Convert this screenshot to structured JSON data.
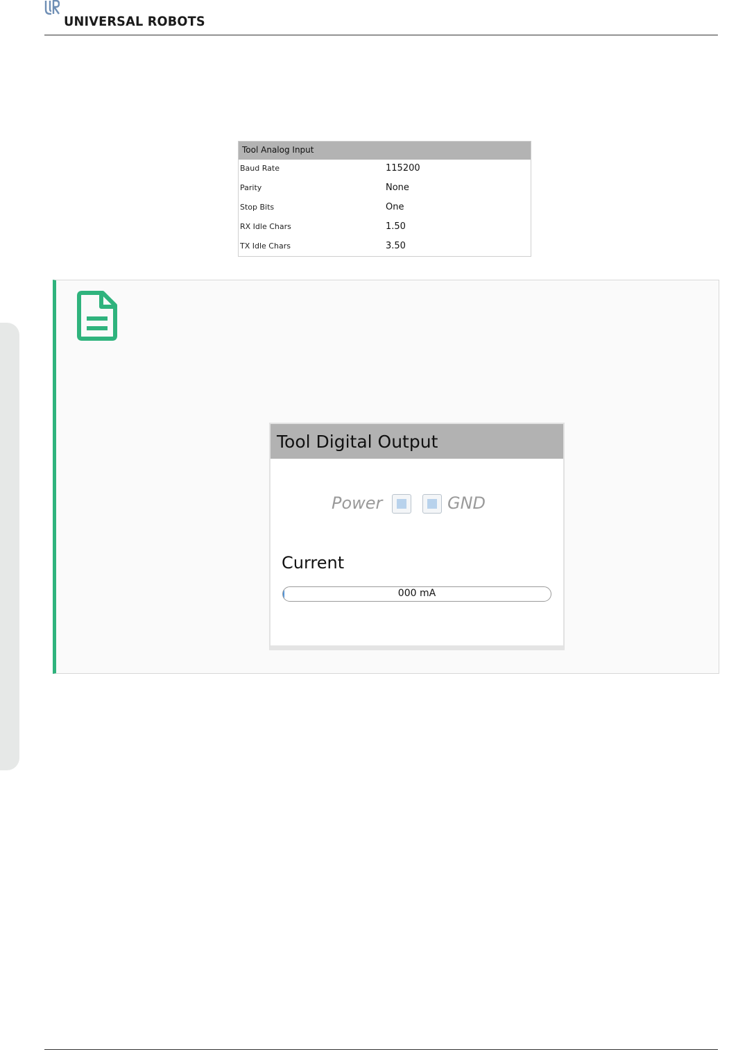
{
  "header": {
    "brand_name": "UNIVERSAL ROBOTS",
    "logo_icon": "ur-logo-icon"
  },
  "analog_panel": {
    "title": "Tool Analog Input",
    "rows": [
      {
        "label": "Baud Rate",
        "value": "115200"
      },
      {
        "label": "Parity",
        "value": "None"
      },
      {
        "label": "Stop Bits",
        "value": "One"
      },
      {
        "label": "RX Idle Chars",
        "value": "1.50"
      },
      {
        "label": "TX Idle Chars",
        "value": "3.50"
      }
    ]
  },
  "note": {
    "icon": "note-document-icon",
    "accent_color": "#2fb37d"
  },
  "digital_panel": {
    "title": "Tool Digital Output",
    "power_label": "Power",
    "gnd_label": "GND",
    "current_label": "Current",
    "current_value_text": "000 mA",
    "current_level_percent": 0.5
  },
  "colors": {
    "header_gray": "#b3b3b3",
    "checkbox_fill": "#b8d2ec",
    "side_tab": "#e6e8e7"
  }
}
